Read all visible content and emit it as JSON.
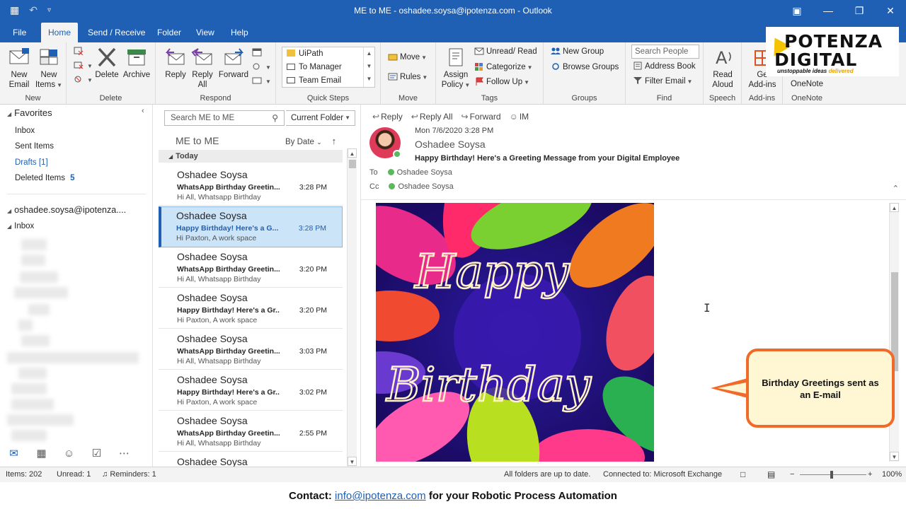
{
  "window": {
    "title": "ME to ME - oshadee.soysa@ipotenza.com - Outlook"
  },
  "tabs": [
    {
      "label": "File"
    },
    {
      "label": "Home"
    },
    {
      "label": "Send / Receive"
    },
    {
      "label": "Folder"
    },
    {
      "label": "View"
    },
    {
      "label": "Help"
    }
  ],
  "ribbon": {
    "new": {
      "group": "New",
      "new_email": "New\nEmail",
      "new_email_l1": "New",
      "new_email_l2": "Email",
      "new_items_l1": "New",
      "new_items_l2": "Items"
    },
    "delete": {
      "group": "Delete",
      "delete": "Delete",
      "archive": "Archive"
    },
    "respond": {
      "group": "Respond",
      "reply": "Reply",
      "reply_all_l1": "Reply",
      "reply_all_l2": "All",
      "forward": "Forward"
    },
    "quick_steps": {
      "group": "Quick Steps",
      "items": [
        "UiPath",
        "To Manager",
        "Team Email"
      ]
    },
    "move": {
      "group": "Move",
      "move": "Move",
      "rules": "Rules"
    },
    "tags": {
      "group": "Tags",
      "assign_l1": "Assign",
      "assign_l2": "Policy",
      "unread_read": "Unread/ Read",
      "categorize": "Categorize",
      "follow_up": "Follow Up"
    },
    "groups": {
      "group": "Groups",
      "new_group": "New Group",
      "browse_groups": "Browse Groups"
    },
    "find": {
      "group": "Find",
      "search_people": "Search People",
      "address_book": "Address Book",
      "filter_email": "Filter Email"
    },
    "speech": {
      "group": "Speech",
      "read_l1": "Read",
      "read_l2": "Aloud"
    },
    "addins": {
      "group": "Add-ins",
      "get_l1": "Ge",
      "get_l2": "Add-ins"
    },
    "onenote": {
      "group": "OneNote",
      "label": "OneNote"
    }
  },
  "logo": {
    "line1": "POTENZA",
    "line2": "DIGITAL",
    "tagline_a": "unstoppable ideas",
    "tagline_b": "delivered"
  },
  "folders": {
    "favorites": "Favorites",
    "inbox": "Inbox",
    "sent": "Sent Items",
    "drafts": "Drafts [1]",
    "deleted": "Deleted Items",
    "deleted_count": "5",
    "account": "oshadee.soysa@ipotenza....",
    "account_inbox": "Inbox"
  },
  "list": {
    "search_placeholder": "Search ME to ME",
    "scope": "Current Folder",
    "folder_title": "ME to ME",
    "sort": "By Date",
    "group": "Today",
    "messages": [
      {
        "sender": "Oshadee Soysa",
        "subject": "WhatsApp Birthday Greetin...",
        "time": "3:28 PM",
        "preview": "Hi All,  Whatsapp Birthday"
      },
      {
        "sender": "Oshadee Soysa",
        "subject": "Happy Birthday! Here's a G...",
        "time": "3:28 PM",
        "preview": "Hi Paxton,  A work space"
      },
      {
        "sender": "Oshadee Soysa",
        "subject": "WhatsApp Birthday Greetin...",
        "time": "3:20 PM",
        "preview": "Hi All,  Whatsapp Birthday"
      },
      {
        "sender": "Oshadee Soysa",
        "subject": "Happy Birthday! Here's a Gr...",
        "time": "3:20 PM",
        "preview": "Hi Paxton,  A work space"
      },
      {
        "sender": "Oshadee Soysa",
        "subject": "WhatsApp Birthday Greetin...",
        "time": "3:03 PM",
        "preview": "Hi All,  Whatsapp Birthday"
      },
      {
        "sender": "Oshadee Soysa",
        "subject": "Happy Birthday! Here's a Gr...",
        "time": "3:02 PM",
        "preview": "Hi Paxton,  A work space"
      },
      {
        "sender": "Oshadee Soysa",
        "subject": "WhatsApp Birthday Greetin...",
        "time": "2:55 PM",
        "preview": "Hi All,  Whatsapp Birthday"
      },
      {
        "sender": "Oshadee Soysa",
        "subject": "",
        "time": "",
        "preview": ""
      }
    ]
  },
  "reading": {
    "actions": {
      "reply": "Reply",
      "reply_all": "Reply All",
      "forward": "Forward",
      "im": "IM"
    },
    "date": "Mon 7/6/2020 3:28 PM",
    "sender": "Oshadee Soysa",
    "subject": "Happy Birthday! Here's a Greeting Message from your Digital Employee",
    "to_label": "To",
    "to": "Oshadee Soysa",
    "cc_label": "Cc",
    "cc": "Oshadee Soysa",
    "image_text_1": "Happy",
    "image_text_2": "Birthday"
  },
  "callout": {
    "text": "Birthday Greetings sent as an E-mail"
  },
  "status": {
    "items": "Items: 202",
    "unread": "Unread: 1",
    "reminders": "Reminders: 1",
    "sync": "All folders are up to date.",
    "connection": "Connected to: Microsoft Exchange",
    "zoom": "100%"
  },
  "footer": {
    "prefix": "Contact: ",
    "email": "info@ipotenza.com",
    "suffix": " for your Robotic Process Automation"
  },
  "colors": {
    "accent": "#1f5fb4",
    "callout_border": "#f06b2a",
    "callout_fill": "#fff7d4",
    "presence": "#5cb85c"
  }
}
